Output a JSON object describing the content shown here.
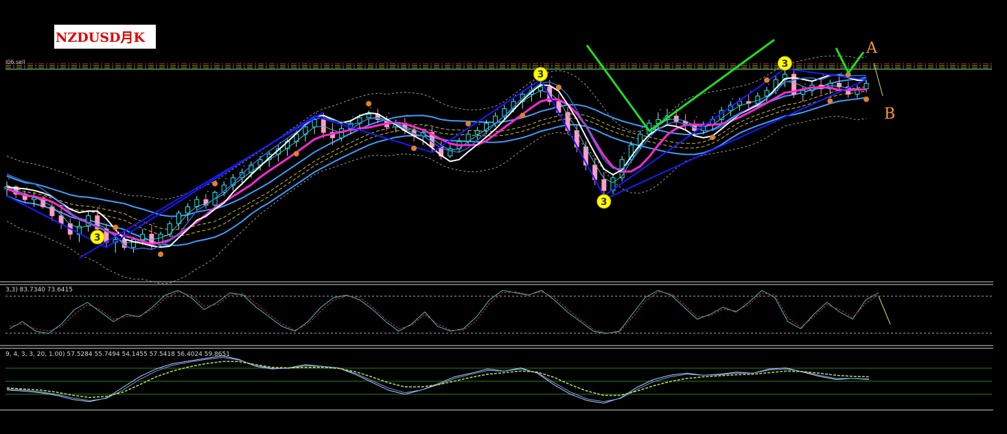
{
  "title": "NZDUSD月K",
  "level_label": "l06.sell",
  "annotations": {
    "a": "A",
    "b": "B"
  },
  "wave_markers": [
    "3",
    "3",
    "3",
    "3"
  ],
  "indicator1": {
    "readout": "3,3) 83.7340 73.6415"
  },
  "indicator2": {
    "readout": "9, 4, 3, 3, 20, 1.00) 57.5284 55.7494 54.1455 57.5418 56.4024 59.8651"
  },
  "colors": {
    "background": "#000000",
    "title_text": "#e00000",
    "candle_up": "#ffffff",
    "candle_down": "#ff9cc7",
    "candle_outline": "#00ffff",
    "wave_line": "#1a1aff",
    "ma_magenta": "#ff2ad4",
    "ma_white": "#ffffff",
    "ma_blue": "#2a70d8",
    "band_blue": "#3aa0ff",
    "yellow_dash": "#d8c23a",
    "green_pattern": "#22dd22",
    "annotation": "#ff9933",
    "marker_circle": "#ffff00",
    "dot_orange": "#e0802a",
    "cyan_line": "#3fc6cf",
    "red_dash": "#e0302a"
  },
  "chart_data": [
    {
      "type": "candlestick",
      "title": "NZDUSD月K",
      "note": "Monthly NZDUSD price pane; price axis not printed in the screenshot, values approximate relative levels",
      "candles_relative": [
        [
          0.32,
          0.36,
          0.28,
          0.33
        ],
        [
          0.33,
          0.34,
          0.27,
          0.29
        ],
        [
          0.29,
          0.31,
          0.24,
          0.26
        ],
        [
          0.26,
          0.3,
          0.22,
          0.27
        ],
        [
          0.27,
          0.28,
          0.21,
          0.22
        ],
        [
          0.22,
          0.24,
          0.16,
          0.18
        ],
        [
          0.18,
          0.21,
          0.13,
          0.15
        ],
        [
          0.15,
          0.17,
          0.09,
          0.11
        ],
        [
          0.11,
          0.16,
          0.08,
          0.14
        ],
        [
          0.14,
          0.2,
          0.12,
          0.18
        ],
        [
          0.18,
          0.21,
          0.12,
          0.13
        ],
        [
          0.13,
          0.15,
          0.06,
          0.08
        ],
        [
          0.08,
          0.11,
          0.04,
          0.09
        ],
        [
          0.09,
          0.12,
          0.05,
          0.06
        ],
        [
          0.06,
          0.1,
          0.04,
          0.09
        ],
        [
          0.09,
          0.13,
          0.07,
          0.11
        ],
        [
          0.11,
          0.14,
          0.05,
          0.07
        ],
        [
          0.07,
          0.12,
          0.06,
          0.11
        ],
        [
          0.11,
          0.16,
          0.1,
          0.15
        ],
        [
          0.15,
          0.2,
          0.13,
          0.19
        ],
        [
          0.19,
          0.24,
          0.16,
          0.22
        ],
        [
          0.22,
          0.28,
          0.2,
          0.26
        ],
        [
          0.26,
          0.29,
          0.21,
          0.23
        ],
        [
          0.23,
          0.31,
          0.22,
          0.3
        ],
        [
          0.3,
          0.36,
          0.28,
          0.34
        ],
        [
          0.34,
          0.4,
          0.31,
          0.38
        ],
        [
          0.38,
          0.43,
          0.34,
          0.41
        ],
        [
          0.41,
          0.47,
          0.38,
          0.45
        ],
        [
          0.45,
          0.5,
          0.42,
          0.48
        ],
        [
          0.48,
          0.53,
          0.44,
          0.51
        ],
        [
          0.51,
          0.56,
          0.47,
          0.54
        ],
        [
          0.54,
          0.6,
          0.5,
          0.58
        ],
        [
          0.58,
          0.64,
          0.55,
          0.62
        ],
        [
          0.62,
          0.68,
          0.58,
          0.66
        ],
        [
          0.66,
          0.72,
          0.62,
          0.7
        ],
        [
          0.7,
          0.74,
          0.6,
          0.63
        ],
        [
          0.63,
          0.68,
          0.56,
          0.6
        ],
        [
          0.6,
          0.67,
          0.58,
          0.65
        ],
        [
          0.65,
          0.7,
          0.62,
          0.68
        ],
        [
          0.68,
          0.73,
          0.64,
          0.71
        ],
        [
          0.71,
          0.75,
          0.67,
          0.73
        ],
        [
          0.73,
          0.76,
          0.68,
          0.7
        ],
        [
          0.7,
          0.72,
          0.64,
          0.66
        ],
        [
          0.66,
          0.7,
          0.63,
          0.68
        ],
        [
          0.68,
          0.71,
          0.62,
          0.64
        ],
        [
          0.64,
          0.67,
          0.58,
          0.61
        ],
        [
          0.61,
          0.65,
          0.56,
          0.63
        ],
        [
          0.63,
          0.66,
          0.52,
          0.55
        ],
        [
          0.55,
          0.58,
          0.48,
          0.5
        ],
        [
          0.5,
          0.56,
          0.49,
          0.54
        ],
        [
          0.54,
          0.6,
          0.52,
          0.58
        ],
        [
          0.58,
          0.64,
          0.56,
          0.62
        ],
        [
          0.62,
          0.66,
          0.59,
          0.64
        ],
        [
          0.64,
          0.7,
          0.62,
          0.68
        ],
        [
          0.68,
          0.74,
          0.66,
          0.72
        ],
        [
          0.72,
          0.78,
          0.7,
          0.76
        ],
        [
          0.76,
          0.82,
          0.74,
          0.8
        ],
        [
          0.8,
          0.86,
          0.76,
          0.84
        ],
        [
          0.84,
          0.9,
          0.8,
          0.86
        ],
        [
          0.86,
          0.92,
          0.82,
          0.88
        ],
        [
          0.88,
          0.92,
          0.78,
          0.8
        ],
        [
          0.8,
          0.84,
          0.72,
          0.74
        ],
        [
          0.74,
          0.77,
          0.62,
          0.64
        ],
        [
          0.64,
          0.67,
          0.52,
          0.55
        ],
        [
          0.55,
          0.58,
          0.42,
          0.45
        ],
        [
          0.45,
          0.49,
          0.34,
          0.37
        ],
        [
          0.37,
          0.41,
          0.28,
          0.31
        ],
        [
          0.31,
          0.4,
          0.29,
          0.38
        ],
        [
          0.38,
          0.5,
          0.36,
          0.48
        ],
        [
          0.48,
          0.58,
          0.46,
          0.56
        ],
        [
          0.56,
          0.64,
          0.54,
          0.62
        ],
        [
          0.62,
          0.7,
          0.6,
          0.68
        ],
        [
          0.68,
          0.74,
          0.64,
          0.7
        ],
        [
          0.7,
          0.76,
          0.67,
          0.72
        ],
        [
          0.72,
          0.76,
          0.66,
          0.69
        ],
        [
          0.69,
          0.73,
          0.64,
          0.67
        ],
        [
          0.67,
          0.7,
          0.62,
          0.64
        ],
        [
          0.64,
          0.69,
          0.62,
          0.67
        ],
        [
          0.67,
          0.72,
          0.64,
          0.7
        ],
        [
          0.7,
          0.77,
          0.68,
          0.75
        ],
        [
          0.75,
          0.8,
          0.72,
          0.78
        ],
        [
          0.78,
          0.82,
          0.75,
          0.8
        ],
        [
          0.8,
          0.84,
          0.76,
          0.79
        ],
        [
          0.79,
          0.85,
          0.77,
          0.83
        ],
        [
          0.83,
          0.88,
          0.8,
          0.86
        ],
        [
          0.86,
          0.94,
          0.84,
          0.92
        ],
        [
          0.92,
          0.98,
          0.88,
          0.95
        ],
        [
          0.95,
          0.97,
          0.82,
          0.84
        ],
        [
          0.84,
          0.88,
          0.8,
          0.86
        ],
        [
          0.86,
          0.91,
          0.83,
          0.89
        ],
        [
          0.89,
          0.93,
          0.84,
          0.87
        ],
        [
          0.87,
          0.92,
          0.84,
          0.9
        ],
        [
          0.9,
          0.94,
          0.86,
          0.88
        ],
        [
          0.88,
          0.91,
          0.82,
          0.84
        ],
        [
          0.84,
          0.89,
          0.82,
          0.87
        ],
        [
          0.87,
          0.92,
          0.85,
          0.9
        ]
      ]
    },
    {
      "type": "line",
      "title": "3,3) 83.7340 73.6415",
      "series": [
        {
          "values": [
            0.15,
            0.3,
            0.1,
            0.05,
            0.25,
            0.55,
            0.7,
            0.5,
            0.3,
            0.45,
            0.4,
            0.6,
            0.85,
            0.95,
            0.8,
            0.55,
            0.7,
            0.9,
            0.85,
            0.6,
            0.4,
            0.2,
            0.1,
            0.3,
            0.6,
            0.8,
            0.85,
            0.75,
            0.55,
            0.3,
            0.1,
            0.25,
            0.5,
            0.2,
            0.1,
            0.15,
            0.4,
            0.75,
            0.95,
            0.9,
            0.85,
            0.95,
            0.75,
            0.5,
            0.3,
            0.1,
            0.05,
            0.1,
            0.45,
            0.8,
            0.95,
            0.85,
            0.6,
            0.35,
            0.45,
            0.6,
            0.5,
            0.7,
            0.95,
            0.8,
            0.3,
            0.15,
            0.45,
            0.7,
            0.5,
            0.35,
            0.75,
            0.9
          ]
        },
        {
          "values": [
            0.2,
            0.25,
            0.15,
            0.1,
            0.2,
            0.45,
            0.65,
            0.55,
            0.35,
            0.4,
            0.42,
            0.55,
            0.78,
            0.92,
            0.85,
            0.62,
            0.65,
            0.85,
            0.88,
            0.68,
            0.45,
            0.25,
            0.12,
            0.25,
            0.52,
            0.75,
            0.84,
            0.8,
            0.6,
            0.35,
            0.15,
            0.22,
            0.45,
            0.25,
            0.12,
            0.12,
            0.32,
            0.68,
            0.9,
            0.92,
            0.86,
            0.92,
            0.8,
            0.56,
            0.34,
            0.14,
            0.06,
            0.08,
            0.38,
            0.72,
            0.92,
            0.88,
            0.66,
            0.4,
            0.42,
            0.56,
            0.52,
            0.65,
            0.9,
            0.85,
            0.38,
            0.18,
            0.4,
            0.65,
            0.55,
            0.38,
            0.68,
            0.86
          ]
        }
      ]
    },
    {
      "type": "line",
      "title": "9, 4, 3, 3, 20, 1.00) 57.5284 55.7494 54.1455 57.5418 56.4024 59.8651",
      "series": [
        {
          "values": [
            0.3,
            0.28,
            0.25,
            0.2,
            0.12,
            0.08,
            0.15,
            0.35,
            0.55,
            0.7,
            0.8,
            0.85,
            0.9,
            0.95,
            0.88,
            0.75,
            0.7,
            0.72,
            0.78,
            0.75,
            0.72,
            0.6,
            0.45,
            0.3,
            0.22,
            0.3,
            0.42,
            0.55,
            0.62,
            0.7,
            0.66,
            0.72,
            0.62,
            0.4,
            0.22,
            0.1,
            0.05,
            0.15,
            0.35,
            0.5,
            0.58,
            0.62,
            0.58,
            0.6,
            0.64,
            0.62,
            0.7,
            0.72,
            0.64,
            0.56,
            0.5,
            0.52,
            0.5
          ]
        },
        {
          "values": [
            0.32,
            0.3,
            0.27,
            0.22,
            0.15,
            0.1,
            0.14,
            0.3,
            0.5,
            0.66,
            0.77,
            0.83,
            0.88,
            0.92,
            0.87,
            0.77,
            0.71,
            0.71,
            0.76,
            0.75,
            0.72,
            0.62,
            0.48,
            0.34,
            0.25,
            0.3,
            0.4,
            0.52,
            0.6,
            0.67,
            0.66,
            0.7,
            0.63,
            0.44,
            0.26,
            0.13,
            0.08,
            0.14,
            0.31,
            0.46,
            0.55,
            0.6,
            0.58,
            0.59,
            0.62,
            0.62,
            0.68,
            0.7,
            0.65,
            0.58,
            0.52,
            0.52,
            0.51
          ]
        },
        {
          "values": [
            0.34,
            0.32,
            0.3,
            0.26,
            0.2,
            0.16,
            0.18,
            0.26,
            0.4,
            0.55,
            0.66,
            0.74,
            0.8,
            0.84,
            0.84,
            0.78,
            0.73,
            0.72,
            0.73,
            0.73,
            0.71,
            0.65,
            0.55,
            0.44,
            0.36,
            0.36,
            0.4,
            0.47,
            0.54,
            0.6,
            0.63,
            0.66,
            0.64,
            0.54,
            0.4,
            0.28,
            0.2,
            0.2,
            0.28,
            0.38,
            0.46,
            0.52,
            0.55,
            0.57,
            0.59,
            0.6,
            0.63,
            0.66,
            0.65,
            0.62,
            0.58,
            0.56,
            0.55
          ]
        }
      ]
    }
  ]
}
